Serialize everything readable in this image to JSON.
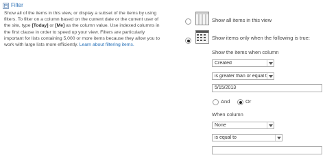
{
  "section": {
    "title": "Filter",
    "collapse_symbol": "⊟"
  },
  "description": {
    "part1": "Show all of the items in this view, or display a subset of the items by using filters. To filter on a column based on the current date or the current user of the site, type ",
    "token_today": "[Today]",
    "part2": " or ",
    "token_me": "[Me]",
    "part3": " as the column value. Use indexed columns in the first clause in order to speed up your view. Filters are particularly important for lists containing 5,000 or more items because they allow you to work with large lists more efficiently. ",
    "link": "Learn about filtering items."
  },
  "options": {
    "show_all": {
      "label": "Show all items in this view",
      "selected": false,
      "icon": "all-items-icon"
    },
    "show_filtered": {
      "label": "Show items only when the following is true:",
      "selected": true,
      "icon": "filtered-items-icon"
    }
  },
  "clause1": {
    "column_label": "Show the items when column",
    "column_value": "Created",
    "operator_value": "is greater than or equal to",
    "value": "5/15/2013"
  },
  "logic": {
    "and_label": "And",
    "or_label": "Or",
    "selected": "Or"
  },
  "clause2": {
    "column_label": "When column",
    "column_value": "None",
    "operator_value": "is equal to",
    "value": ""
  },
  "colors": {
    "accent": "#2a6fb5",
    "text": "#444444",
    "border": "#ababab"
  }
}
